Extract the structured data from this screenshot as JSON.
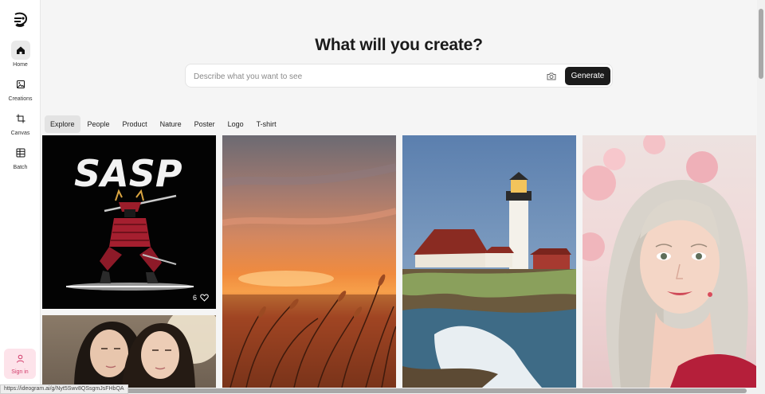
{
  "sidebar": {
    "items": [
      {
        "label": "Home",
        "icon": "home-icon",
        "active": true
      },
      {
        "label": "Creations",
        "icon": "image-icon",
        "active": false
      },
      {
        "label": "Canvas",
        "icon": "crop-icon",
        "active": false
      },
      {
        "label": "Batch",
        "icon": "grid-icon",
        "active": false
      }
    ],
    "signin_label": "Sign in"
  },
  "main": {
    "headline": "What will you create?",
    "prompt_placeholder": "Describe what you want to see",
    "generate_label": "Generate",
    "tabs": [
      "Explore",
      "People",
      "Product",
      "Nature",
      "Poster",
      "Logo",
      "T-shirt"
    ],
    "active_tab": "Explore"
  },
  "gallery": {
    "tile1_text": "SASP",
    "tile1_likes": "6"
  },
  "status_url": "https://ideogram.ai/g/Nyt5Swv8QSsgmJsFHbQA"
}
